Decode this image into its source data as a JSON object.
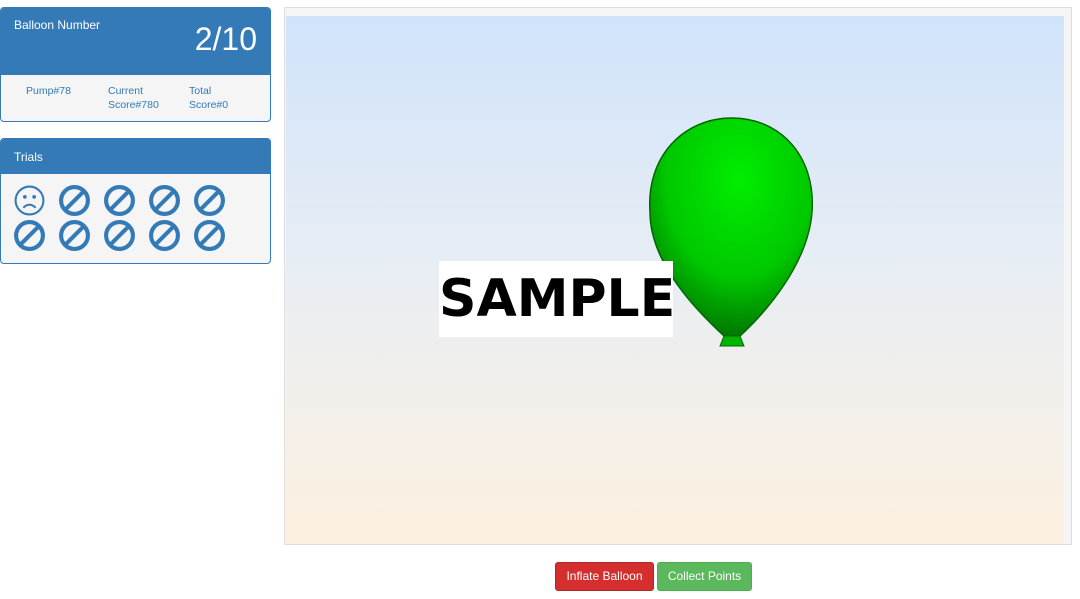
{
  "score": {
    "balloon_label": "Balloon Number",
    "balloon_value": "2/10",
    "pump": "Pump#78",
    "current_score_line1": "Current",
    "current_score_line2": "Score#780",
    "total_score_line1": "Total",
    "total_score_line2": "Score#0"
  },
  "trials": {
    "title": "Trials",
    "results": [
      "popped",
      "pending",
      "pending",
      "pending",
      "pending",
      "pending",
      "pending",
      "pending",
      "pending",
      "pending"
    ],
    "icons": {
      "popped": "sad-face-icon",
      "pending": "prohibited-icon"
    },
    "icon_color": "#337ab7"
  },
  "game": {
    "sample_text": "SAMPLE",
    "balloon_color": "#00cc00"
  },
  "buttons": {
    "inflate": "Inflate Balloon",
    "collect": "Collect Points"
  },
  "colors": {
    "primary": "#337ab7",
    "danger": "#d42e2e",
    "success": "#5cb85c"
  }
}
